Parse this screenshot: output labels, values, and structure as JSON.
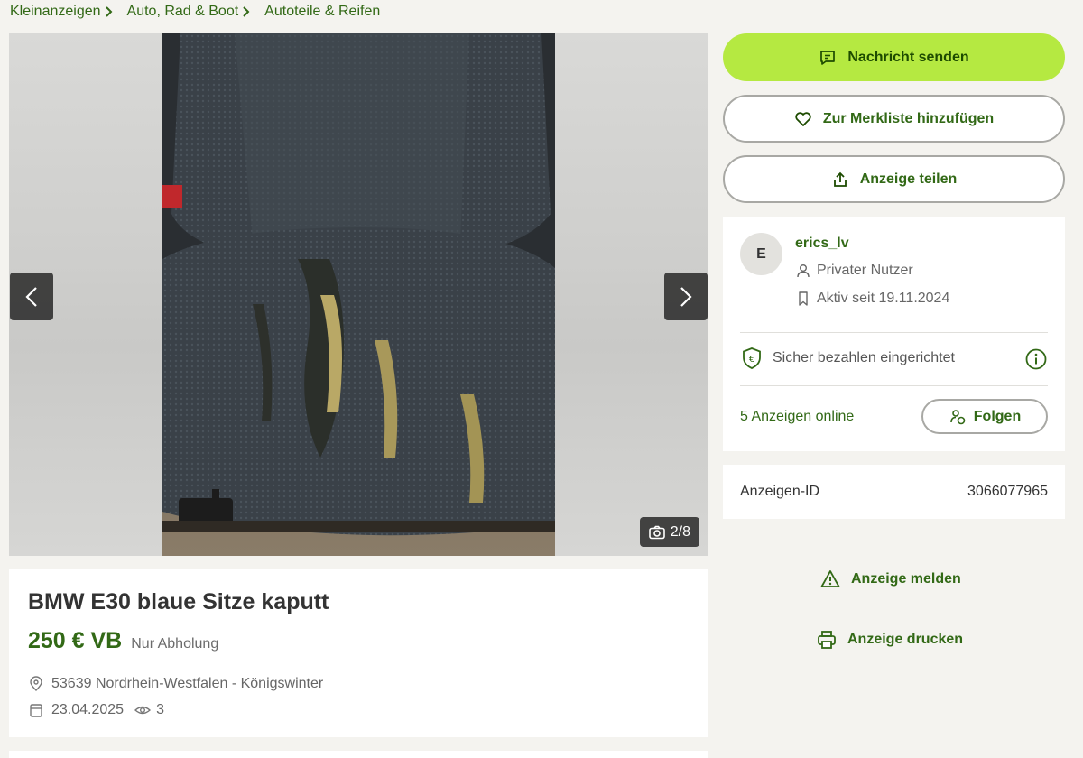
{
  "breadcrumb": [
    "Kleinanzeigen",
    "Auto, Rad & Boot",
    "Autoteile & Reifen"
  ],
  "gallery": {
    "counter": "2/8"
  },
  "ad": {
    "title": "BMW E30 blaue Sitze kaputt",
    "price": "250 € VB",
    "shipping": "Nur Abholung",
    "location": "53639 Nordrhein-Westfalen - Königswinter",
    "date": "23.04.2025",
    "views": "3"
  },
  "actions": {
    "message": "Nachricht senden",
    "watchlist": "Zur Merkliste hinzufügen",
    "share": "Anzeige teilen",
    "report": "Anzeige melden",
    "print": "Anzeige drucken"
  },
  "seller": {
    "initial": "E",
    "name": "erics_lv",
    "type": "Privater Nutzer",
    "since": "Aktiv seit 19.11.2024",
    "secure_payment": "Sicher bezahlen eingerichtet",
    "ads_online": "5 Anzeigen online",
    "follow": "Folgen"
  },
  "ad_id": {
    "label": "Anzeigen-ID",
    "value": "3066077965"
  },
  "colors": {
    "brand_green": "#326916",
    "primary_button": "#b5e941",
    "background": "#f4f3ef"
  }
}
